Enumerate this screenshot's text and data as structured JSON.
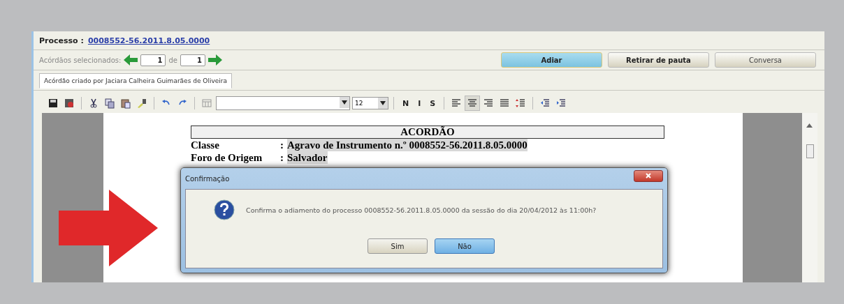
{
  "processo": {
    "label": "Processo :",
    "number": "0008552-56.2011.8.05.0000"
  },
  "navigation": {
    "label": "Acórdãos selecionados:",
    "current": "1",
    "separator": "de",
    "total": "1"
  },
  "actions": [
    {
      "label": "Adiar",
      "highlighted": true
    },
    {
      "label": "Retirar de pauta",
      "highlighted": false
    },
    {
      "label": "Conversa",
      "highlighted": false
    }
  ],
  "tabs": [
    {
      "label": "Acórdão criado por Jaciara Calheira Guimarães de Oliveira",
      "selected": true
    }
  ],
  "toolbar": [
    {
      "kind": "save"
    },
    {
      "kind": "save-as"
    },
    {
      "kind": "sep"
    },
    {
      "kind": "cut"
    },
    {
      "kind": "copy"
    },
    {
      "kind": "paste"
    },
    {
      "kind": "brush"
    },
    {
      "kind": "sep"
    },
    {
      "kind": "undo"
    },
    {
      "kind": "redo"
    },
    {
      "kind": "sep"
    },
    {
      "kind": "table"
    },
    {
      "kind": "font"
    },
    {
      "kind": "size",
      "value": "12"
    },
    {
      "kind": "sep"
    },
    {
      "kind": "letter",
      "label": "N",
      "pressed": false
    },
    {
      "kind": "letter",
      "label": "I",
      "pressed": false
    },
    {
      "kind": "letter",
      "label": "S",
      "pressed": false
    },
    {
      "kind": "sep"
    },
    {
      "kind": "align-left",
      "pressed": false
    },
    {
      "kind": "align-center",
      "pressed": true
    },
    {
      "kind": "align-right",
      "pressed": false
    },
    {
      "kind": "justify",
      "pressed": false
    },
    {
      "kind": "spacing",
      "pressed": false
    },
    {
      "kind": "sep"
    },
    {
      "kind": "outdent",
      "pressed": false
    },
    {
      "kind": "indent",
      "pressed": false
    }
  ],
  "document": {
    "title": "ACORDÃO",
    "fields": [
      {
        "label": "Classe",
        "separator": ":",
        "value": "Agravo de Instrumento n.º 0008552-56.2011.8.05.0000"
      },
      {
        "label": "Foro de Origem",
        "separator": ":",
        "value": "Salvador"
      }
    ]
  },
  "dialog": {
    "title": "Confirmação",
    "message": "Confirma o adiamento do processo 0008552-56.2011.8.05.0000 da sessão do dia 20/04/2012 às 11:00h?",
    "buttons": [
      {
        "label": "Sim",
        "default": false
      },
      {
        "label": "Não",
        "default": true
      }
    ]
  }
}
